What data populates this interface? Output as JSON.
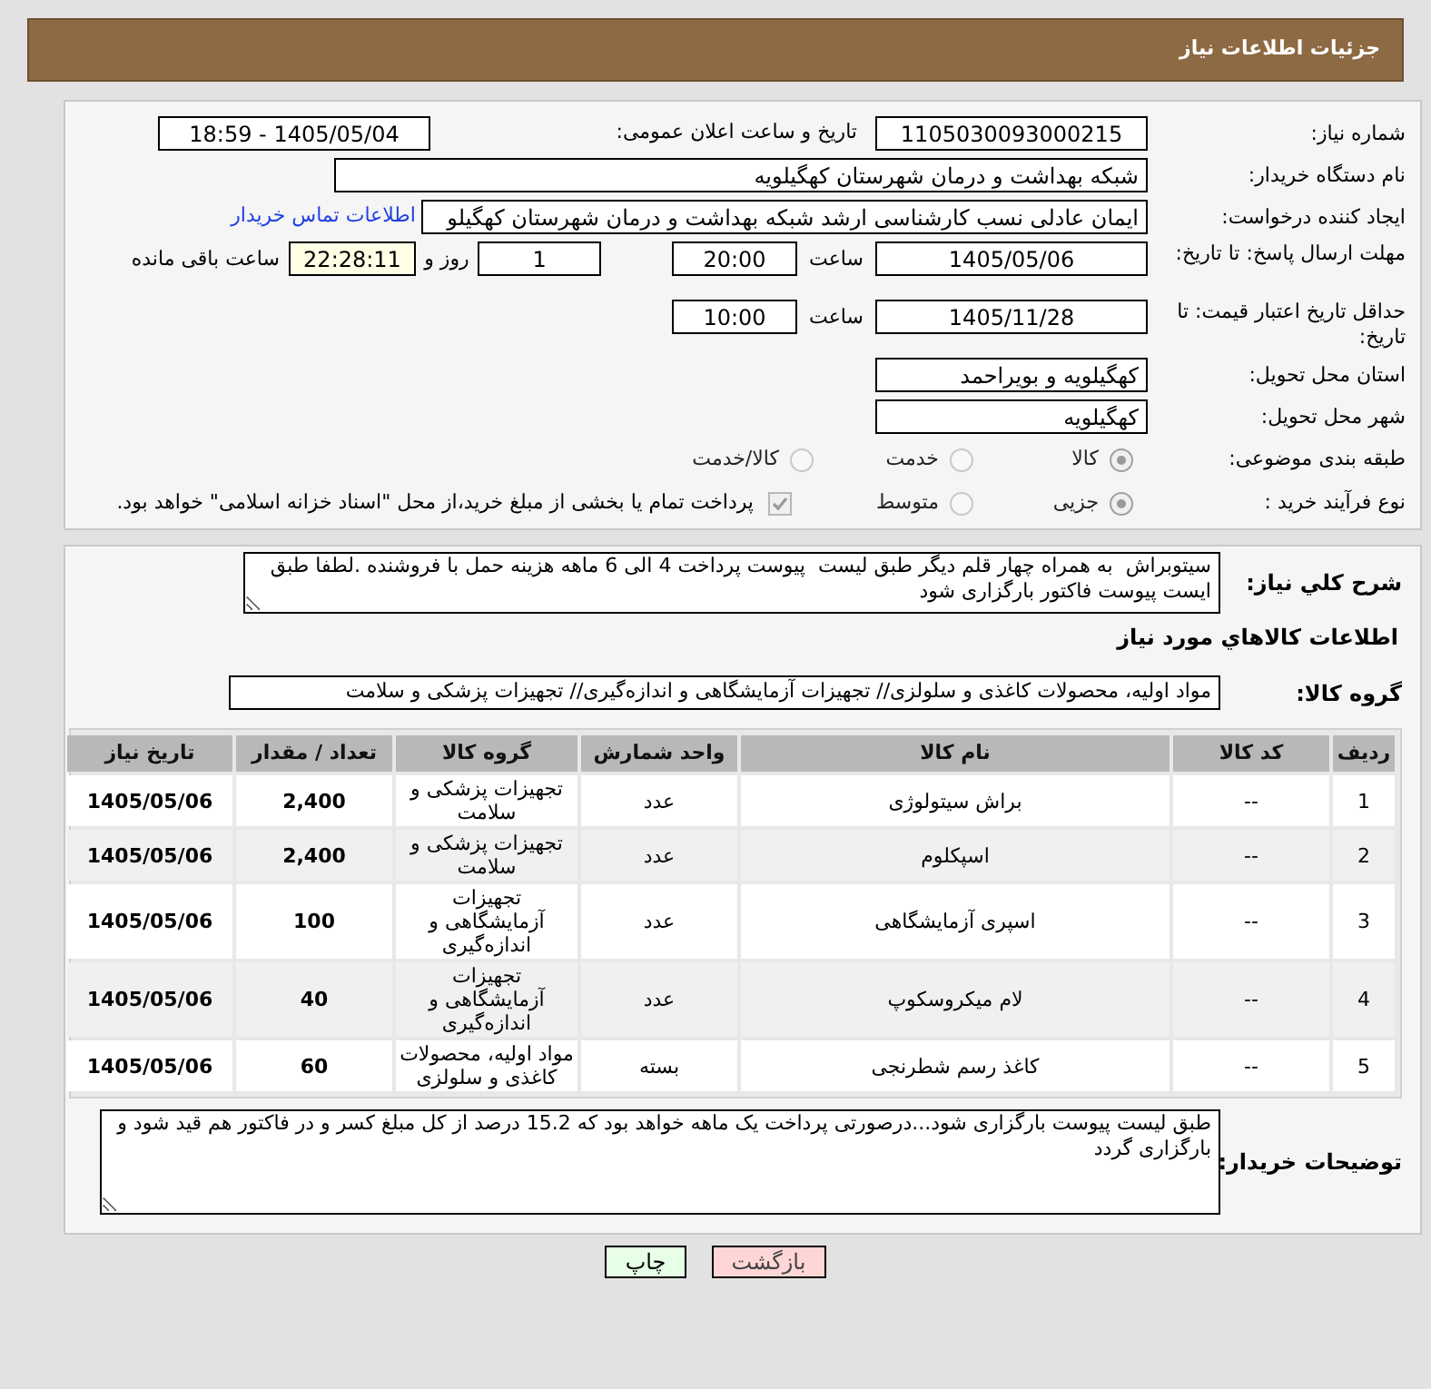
{
  "header": {
    "title": "جزئیات اطلاعات نیاز"
  },
  "need_number": {
    "label": "شماره نیاز:",
    "value": "1105030093000215"
  },
  "announce": {
    "label": "تاریخ و ساعت اعلان عمومی:",
    "value": "1405/05/04 - 18:59"
  },
  "buyer_org": {
    "label": "نام دستگاه خریدار:",
    "value": "شبکه بهداشت و درمان شهرستان کهگیلویه"
  },
  "requester": {
    "label": "ایجاد کننده درخواست:",
    "value": "ایمان عادلی نسب کارشناسی ارشد شبکه بهداشت و درمان شهرستان کهگیلو",
    "link": "اطلاعات تماس خریدار"
  },
  "deadline": {
    "label": "مهلت ارسال پاسخ: تا تاریخ:",
    "date": "1405/05/06",
    "time_label": "ساعت",
    "time": "20:00",
    "days": "1",
    "days_label": "روز و",
    "remaining": "22:28:11",
    "remaining_label": "ساعت باقی مانده"
  },
  "price_validity": {
    "label": "حداقل تاریخ اعتبار قیمت: تا تاریخ:",
    "date": "1405/11/28",
    "time_label": "ساعت",
    "time": "10:00"
  },
  "province": {
    "label": "استان محل تحویل:",
    "value": "کهگیلویه و بویراحمد"
  },
  "city": {
    "label": "شهر محل تحویل:",
    "value": "کهگیلویه"
  },
  "category": {
    "label": "طبقه بندی موضوعی:",
    "options": [
      {
        "label": "کالا",
        "selected": true
      },
      {
        "label": "خدمت",
        "selected": false
      },
      {
        "label": "کالا/خدمت",
        "selected": false
      }
    ]
  },
  "process": {
    "label": "نوع فرآیند خرید :",
    "options": [
      {
        "label": "جزیی",
        "selected": true
      },
      {
        "label": "متوسط",
        "selected": false
      }
    ],
    "payment": {
      "checked": true,
      "text": "پرداخت تمام یا بخشی از مبلغ خرید،از محل \"اسناد خزانه اسلامی\" خواهد بود."
    }
  },
  "description": {
    "label": "شرح کلي نیاز:",
    "value": "سیتوبراش  به همراه چهار قلم دیگر طبق لیست  پیوست پرداخت 4 الی 6 ماهه هزینه حمل با فروشنده .لطفا طبق ایست پیوست فاکتور بارگزاری شود"
  },
  "goods_title": "اطلاعات کالاهاي مورد نیاز",
  "goods_group": {
    "label": "گروه کالا:",
    "value": "مواد اولیه، محصولات کاغذی و سلولزی// تجهیزات آزمایشگاهی و اندازه‌گیری// تجهیزات پزشکی و سلامت"
  },
  "table": {
    "columns": [
      "ردیف",
      "کد کالا",
      "نام کالا",
      "واحد شمارش",
      "گروه کالا",
      "تعداد / مقدار",
      "تاریخ نیاز"
    ],
    "rows": [
      [
        "1",
        "--",
        "براش سیتولوژی",
        "عدد",
        "تجهیزات پزشکی و سلامت",
        "2,400",
        "1405/05/06"
      ],
      [
        "2",
        "--",
        "اسپکلوم",
        "عدد",
        "تجهیزات پزشکی و سلامت",
        "2,400",
        "1405/05/06"
      ],
      [
        "3",
        "--",
        "اسپری آزمایشگاهی",
        "عدد",
        "تجهیزات آزمایشگاهی و اندازه‌گیری",
        "100",
        "1405/05/06"
      ],
      [
        "4",
        "--",
        "لام میکروسکوپ",
        "عدد",
        "تجهیزات آزمایشگاهی و اندازه‌گیری",
        "40",
        "1405/05/06"
      ],
      [
        "5",
        "--",
        "کاغذ رسم شطرنجی",
        "بسته",
        "مواد اولیه، محصولات کاغذی و سلولزی",
        "60",
        "1405/05/06"
      ]
    ]
  },
  "buyer_notes": {
    "label": "توضیحات خریدار:",
    "value": "طبق لیست پیوست بارگزاری شود...درصورتی پرداخت یک ماهه خواهد بود که 15.2 درصد از کل مبلغ کسر و در فاکتور هم قید شود و بارگزاری گردد"
  },
  "buttons": [
    {
      "label": "بازگشت",
      "kind": "back"
    },
    {
      "label": "چاپ",
      "kind": "print"
    }
  ]
}
